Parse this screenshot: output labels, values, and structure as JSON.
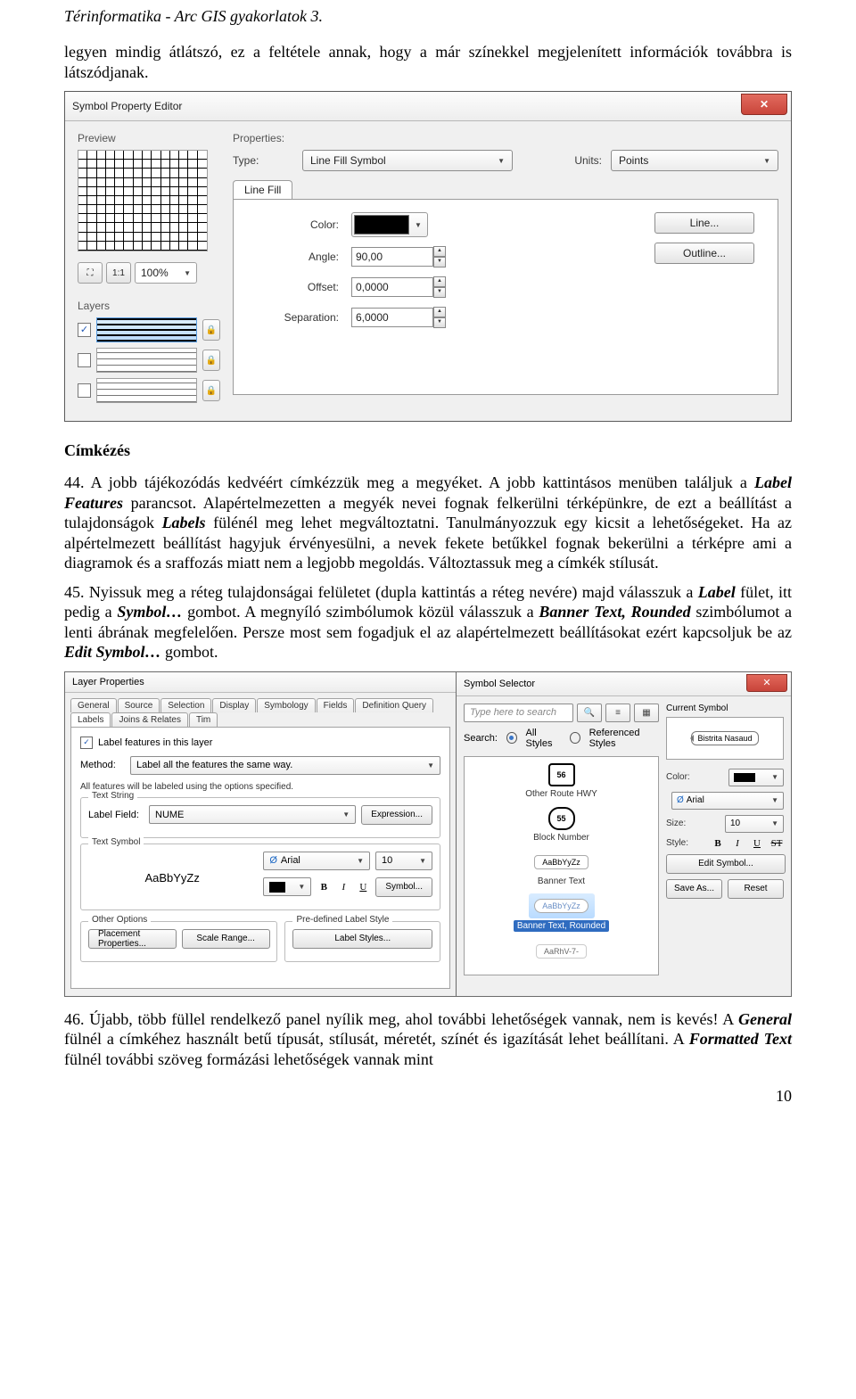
{
  "doc": {
    "header": "Térinformatika - Arc GIS gyakorlatok 3.",
    "intro": "legyen mindig átlátszó, ez a feltétele annak, hogy a már színekkel megjelenített információk továbbra is látszódjanak.",
    "section_heading": "Címkézés",
    "para44_a": "44. A jobb tájékozódás kedvéért címkézzük meg a megyéket. A jobb kattintásos menüben találjuk a ",
    "para44_lf": "Label Features",
    "para44_b": " parancsot. Alapértelmezetten a megyék nevei fognak felkerülni térképünkre, de ezt a beállítást a tulajdonságok ",
    "para44_labels": "Labels",
    "para44_c": " fülénél meg lehet megváltoztatni. Tanulmányozzuk egy kicsit a lehetőségeket. Ha az alpértelmezett beállítást hagyjuk érvényesülni, a nevek fekete betűkkel fognak bekerülni a térképre ami a diagramok és a sraffozás miatt nem a legjobb megoldás. Változtassuk meg a címkék stílusát.",
    "para45_a": "45. Nyissuk meg a réteg tulajdonságai felületet (dupla kattintás a réteg nevére) majd válasszuk a ",
    "para45_label": "Label",
    "para45_b": " fület, itt pedig a ",
    "para45_symbol": "Symbol…",
    "para45_c": " gombot. A megnyíló szimbólumok közül válasszuk a ",
    "para45_banner": "Banner Text, Rounded",
    "para45_d": " szimbólumot a lenti ábrának megfelelően. Persze most sem fogadjuk el az alapértelmezett beállításokat ezért kapcsoljuk be az ",
    "para45_edit": "Edit Symbol…",
    "para45_e": " gombot.",
    "para46_a": "46. Újabb, több füllel rendelkező panel nyílik meg, ahol további lehetőségek vannak, nem is kevés! A ",
    "para46_general": "General",
    "para46_b": " fülnél a címkéhez használt betű típusát, stílusát, méretét, színét és igazítását lehet beállítani. A ",
    "para46_formatted": "Formatted Text",
    "para46_c": " fülnél további szöveg formázási lehetőségek vannak mint",
    "page_number": "10"
  },
  "spe": {
    "title": "Symbol Property Editor",
    "preview": "Preview",
    "properties": "Properties:",
    "type_label": "Type:",
    "type_value": "Line Fill Symbol",
    "units_label": "Units:",
    "units_value": "Points",
    "tab": "Line Fill",
    "color_label": "Color:",
    "angle_label": "Angle:",
    "angle_value": "90,00",
    "offset_label": "Offset:",
    "offset_value": "0,0000",
    "separation_label": "Separation:",
    "separation_value": "6,0000",
    "line_btn": "Line...",
    "outline_btn": "Outline...",
    "zoom100": "100%",
    "layers": "Layers",
    "tool_11": "1:1"
  },
  "lp": {
    "title": "Layer Properties",
    "tabs": [
      "General",
      "Source",
      "Selection",
      "Display",
      "Symbology",
      "Fields",
      "Definition Query",
      "Labels",
      "Joins & Relates",
      "Tim"
    ],
    "active_tab": "Labels",
    "chk_label": "Label features in this layer",
    "method_label": "Method:",
    "method_value": "Label all the features the same way.",
    "note": "All features will be labeled using the options specified.",
    "grp_textstring": "Text String",
    "labelfield_label": "Label Field:",
    "labelfield_value": "NUME",
    "expression_btn": "Expression...",
    "grp_textsymbol": "Text Symbol",
    "sample": "AaBbYyZz",
    "font": "Arial",
    "size": "10",
    "symbol_btn": "Symbol...",
    "grp_other": "Other Options",
    "placement_btn": "Placement Properties...",
    "scale_btn": "Scale Range...",
    "grp_predef": "Pre-defined Label Style",
    "labelstyles_btn": "Label Styles..."
  },
  "ss": {
    "title": "Symbol Selector",
    "search_placeholder": "Type here to search",
    "search_label": "Search:",
    "radio_all": "All Styles",
    "radio_ref": "Referenced Styles",
    "items": {
      "route_num": "56",
      "route_label": "Other Route HWY",
      "block_num": "55",
      "block_label": "Block Number",
      "banner_sample": "AaBbYyZz",
      "banner_label": "Banner Text",
      "rounded_sample": "AaBbYyZz",
      "rounded_label": "Banner Text, Rounded",
      "partial": "AaRhV-7-"
    },
    "current_label": "Current Symbol",
    "current_text": "Bistrita Nasaud",
    "color_label": "Color:",
    "font_label": "Arial",
    "size_label": "Size:",
    "size_value": "10",
    "style_label": "Style:",
    "edit_btn": "Edit Symbol...",
    "saveas_btn": "Save As...",
    "reset_btn": "Reset"
  }
}
